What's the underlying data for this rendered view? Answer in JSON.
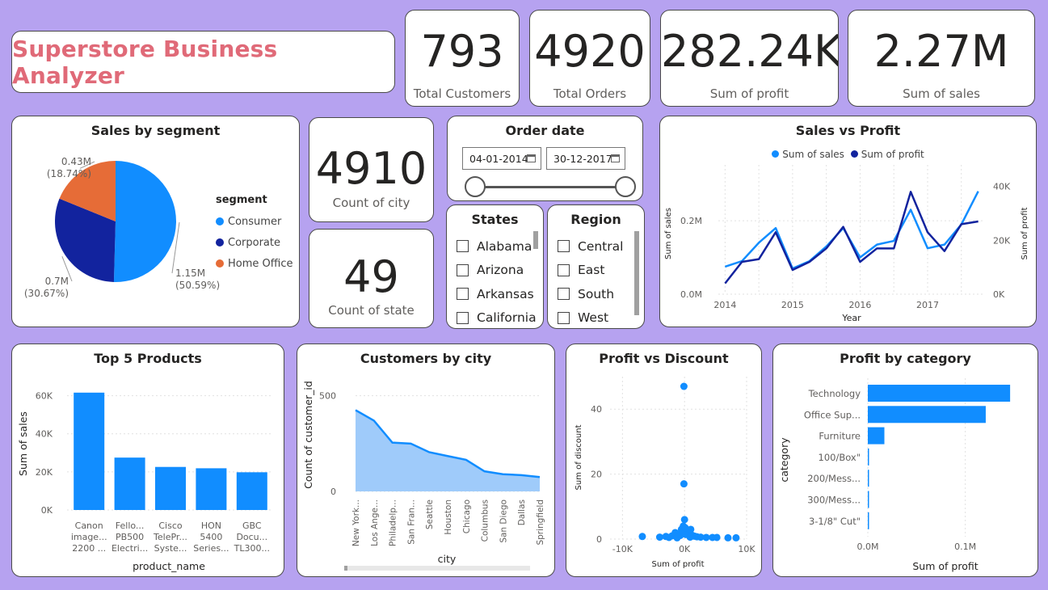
{
  "colors": {
    "accent": "#118dff",
    "dark": "#12239e",
    "orange": "#e66c37",
    "area_fill": "#9fcbfa",
    "title": "#e06a78"
  },
  "header": {
    "title": "Superstore Business Analyzer"
  },
  "kpis": {
    "customers": {
      "value": "793",
      "label": "Total Customers"
    },
    "orders": {
      "value": "4920",
      "label": "Total Orders"
    },
    "profit": {
      "value": "282.24K",
      "label": "Sum of profit"
    },
    "sales": {
      "value": "2.27M",
      "label": "Sum of sales"
    },
    "city": {
      "value": "4910",
      "label": "Count of city"
    },
    "state": {
      "value": "49",
      "label": "Count of state"
    }
  },
  "order_date": {
    "title": "Order date",
    "start": "04-01-2014",
    "end": "30-12-2017"
  },
  "states_slicer": {
    "title": "States",
    "items": [
      "Alabama",
      "Arizona",
      "Arkansas",
      "California"
    ]
  },
  "region_slicer": {
    "title": "Region",
    "items": [
      "Central",
      "East",
      "South",
      "West"
    ]
  },
  "chart_data": [
    {
      "id": "sales_by_segment",
      "type": "pie",
      "title": "Sales by segment",
      "legend_title": "segment",
      "legend_position": "right",
      "categories": [
        "Consumer",
        "Corporate",
        "Home Office"
      ],
      "values": [
        1.15,
        0.7,
        0.43
      ],
      "value_labels": [
        "1.15M",
        "0.7M",
        "0.43M"
      ],
      "percent_labels": [
        "(50.59%)",
        "(30.67%)",
        "(18.74%)"
      ],
      "colors": [
        "#118dff",
        "#12239e",
        "#e66c37"
      ]
    },
    {
      "id": "sales_vs_profit",
      "type": "line",
      "title": "Sales vs Profit",
      "xlabel": "Year",
      "ylabel": "Sum of sales",
      "y2label": "Sum of profit",
      "legend_position": "top",
      "x": [
        2014,
        2014.25,
        2014.5,
        2014.75,
        2015,
        2015.25,
        2015.5,
        2015.75,
        2016,
        2016.25,
        2016.5,
        2016.75,
        2017,
        2017.25,
        2017.5,
        2017.75
      ],
      "xticks": [
        "2014",
        "2015",
        "2016",
        "2017"
      ],
      "ylim": [
        0,
        0.33
      ],
      "yticks": [
        "0.0M",
        "0.2M"
      ],
      "y2lim": [
        0,
        45000
      ],
      "y2ticks": [
        "0K",
        "20K",
        "40K"
      ],
      "series": [
        {
          "name": "Sum of sales",
          "axis": "left",
          "color": "#118dff",
          "values": [
            0.075,
            0.09,
            0.14,
            0.18,
            0.07,
            0.09,
            0.13,
            0.18,
            0.1,
            0.135,
            0.145,
            0.23,
            0.125,
            0.135,
            0.19,
            0.28
          ]
        },
        {
          "name": "Sum of profit",
          "axis": "right",
          "color": "#12239e",
          "values": [
            4000,
            12000,
            13000,
            23000,
            9000,
            12000,
            17000,
            25000,
            12000,
            17000,
            17000,
            38000,
            23000,
            16000,
            26000,
            27000
          ]
        }
      ],
      "grid": true
    },
    {
      "id": "top5_products",
      "type": "bar",
      "title": "Top 5 Products",
      "xlabel": "product_name",
      "ylabel": "Sum of sales",
      "categories": [
        [
          "Canon",
          "image...",
          "2200 ..."
        ],
        [
          "Fello...",
          "PB500",
          "Electri..."
        ],
        [
          "Cisco",
          "TelePr...",
          "Syste..."
        ],
        [
          "HON",
          "5400",
          "Series..."
        ],
        [
          "GBC",
          "Docu...",
          "TL300..."
        ]
      ],
      "values": [
        61600,
        27500,
        22600,
        21900,
        19800
      ],
      "ylim": [
        0,
        70000
      ],
      "yticks": [
        "0K",
        "20K",
        "40K",
        "60K"
      ],
      "color": "#118dff",
      "grid": true
    },
    {
      "id": "customers_by_city",
      "type": "area",
      "title": "Customers by city",
      "xlabel": "city",
      "ylabel": "Count of customer_id",
      "categories": [
        "New York...",
        "Los Ange...",
        "Philadelp...",
        "San Fran...",
        "Seattle",
        "Houston",
        "Chicago",
        "Columbus",
        "San Diego",
        "Dallas",
        "Springfield"
      ],
      "values": [
        425,
        370,
        255,
        250,
        205,
        185,
        165,
        105,
        90,
        85,
        75
      ],
      "ylim": [
        0,
        600
      ],
      "yticks": [
        "0",
        "500"
      ],
      "color": "#118dff",
      "grid": true
    },
    {
      "id": "profit_vs_discount",
      "type": "scatter",
      "title": "Profit vs Discount",
      "xlabel": "Sum of profit",
      "ylabel": "Sum of discount",
      "xlim": [
        -12000,
        10000
      ],
      "xticks": [
        "-10K",
        "0K",
        "10K"
      ],
      "ylim": [
        0,
        50
      ],
      "yticks": [
        "0",
        "20",
        "40"
      ],
      "points": [
        [
          -100,
          47
        ],
        [
          -100,
          17
        ],
        [
          0,
          6
        ],
        [
          -200,
          4
        ],
        [
          -500,
          3
        ],
        [
          300,
          2.5
        ],
        [
          -1500,
          2
        ],
        [
          -1000,
          1.5
        ],
        [
          600,
          1.8
        ],
        [
          1200,
          1.2
        ],
        [
          -2000,
          1
        ],
        [
          -3000,
          0.8
        ],
        [
          -6800,
          0.8
        ],
        [
          -4000,
          0.6
        ],
        [
          2000,
          0.7
        ],
        [
          2600,
          0.6
        ],
        [
          3500,
          0.5
        ],
        [
          4500,
          0.5
        ],
        [
          5200,
          0.5
        ],
        [
          7000,
          0.4
        ],
        [
          8300,
          0.4
        ],
        [
          -2500,
          0.5
        ],
        [
          1600,
          0.9
        ],
        [
          -700,
          1.1
        ],
        [
          200,
          1.4
        ],
        [
          -300,
          2.2
        ],
        [
          900,
          0.6
        ],
        [
          -1200,
          0.4
        ],
        [
          1000,
          3
        ],
        [
          100,
          3.5
        ]
      ],
      "color": "#118dff",
      "grid": true
    },
    {
      "id": "profit_by_category",
      "type": "bar",
      "orientation": "horizontal",
      "title": "Profit by category",
      "xlabel": "Sum of profit",
      "ylabel": "category",
      "categories": [
        "Technology",
        "Office Sup...",
        "Furniture",
        "100/Box\"",
        "200/Mess...",
        "300/Mess...",
        "3-1/8\" Cut\""
      ],
      "values": [
        146000,
        121000,
        17000,
        50,
        40,
        30,
        20
      ],
      "xlim": [
        0,
        160000
      ],
      "xticks": [
        "0.0M",
        "0.1M"
      ],
      "color": "#118dff",
      "grid": true
    }
  ]
}
